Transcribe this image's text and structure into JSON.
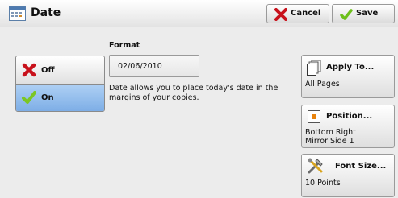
{
  "window": {
    "title": "Date"
  },
  "toolbar": {
    "cancel_label": "Cancel",
    "save_label": "Save"
  },
  "toggle": {
    "off_label": "Off",
    "on_label": "On",
    "selected": "On"
  },
  "format": {
    "label": "Format",
    "value": "02/06/2010",
    "description": "Date allows you to place today's date in the margins of your copies."
  },
  "apply_to": {
    "label": "Apply To...",
    "value": "All Pages"
  },
  "position": {
    "label": "Position...",
    "value_line1": "Bottom Right",
    "value_line2": "Mirror Side 1"
  },
  "font_size": {
    "label": "Font Size...",
    "value": "10 Points"
  },
  "icons": {
    "app": "calendar-icon",
    "cancel": "red-x-icon",
    "save": "green-check-icon",
    "apply_to": "pages-icon",
    "position": "position-icon",
    "font_size": "tools-icon"
  }
}
